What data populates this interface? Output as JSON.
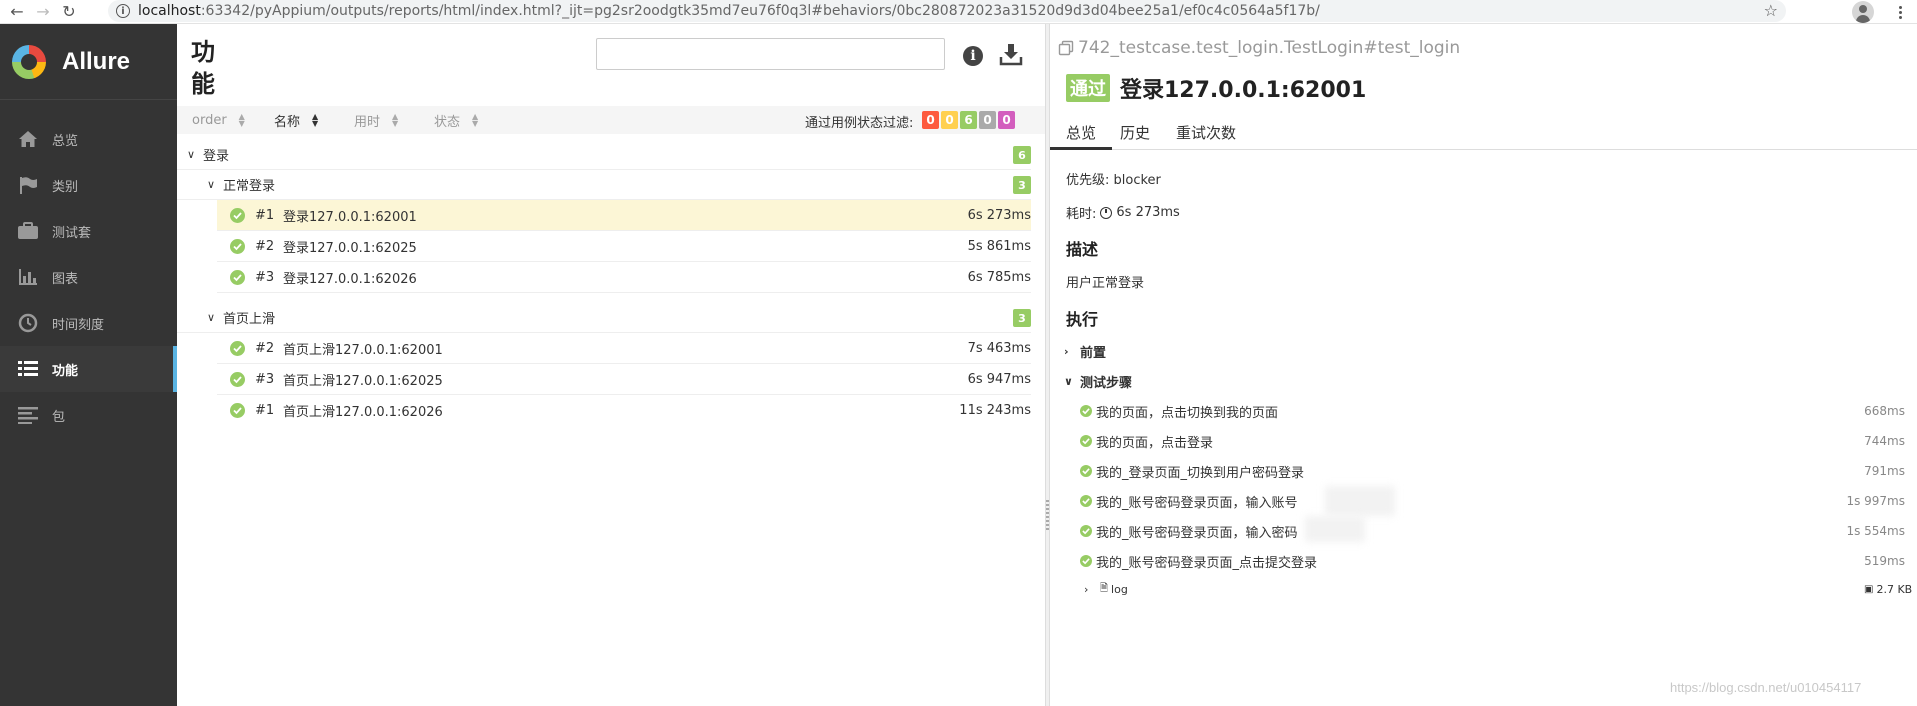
{
  "browser": {
    "url_host": "localhost",
    "url_path": ":63342/pyAppium/outputs/reports/html/index.html?_ijt=pg2sr2oodgtk35md7eu76f0q3l#behaviors/0bc280872023a31520d9d3d04bee25a1/ef0c4c0564a5f17b/"
  },
  "sidebar": {
    "brand": "Allure",
    "items": [
      {
        "label": "总览",
        "icon": "home-icon"
      },
      {
        "label": "类别",
        "icon": "flag-icon"
      },
      {
        "label": "测试套",
        "icon": "briefcase-icon"
      },
      {
        "label": "图表",
        "icon": "bar-chart-icon"
      },
      {
        "label": "时间刻度",
        "icon": "clock-icon"
      },
      {
        "label": "功能",
        "icon": "list-icon",
        "active": true
      },
      {
        "label": "包",
        "icon": "align-left-icon"
      }
    ]
  },
  "middle": {
    "title": "功能",
    "sort": [
      "order",
      "名称",
      "用时",
      "状态"
    ],
    "filter_label": "通过用例状态过滤:",
    "filter_counts": [
      {
        "value": "0",
        "color": "#fd5a3e"
      },
      {
        "value": "0",
        "color": "#ffd050"
      },
      {
        "value": "6",
        "color": "#97cc64"
      },
      {
        "value": "0",
        "color": "#aaaaaa"
      },
      {
        "value": "0",
        "color": "#d35ebe"
      }
    ],
    "tree": {
      "root": {
        "label": "登录",
        "count": "6"
      },
      "groups": [
        {
          "label": "正常登录",
          "count": "3",
          "cases": [
            {
              "num": "#1",
              "name": "登录127.0.0.1:62001",
              "duration": "6s 273ms",
              "selected": true
            },
            {
              "num": "#2",
              "name": "登录127.0.0.1:62025",
              "duration": "5s 861ms"
            },
            {
              "num": "#3",
              "name": "登录127.0.0.1:62026",
              "duration": "6s 785ms"
            }
          ]
        },
        {
          "label": "首页上滑",
          "count": "3",
          "cases": [
            {
              "num": "#2",
              "name": "首页上滑127.0.0.1:62001",
              "duration": "7s 463ms"
            },
            {
              "num": "#3",
              "name": "首页上滑127.0.0.1:62025",
              "duration": "6s 947ms"
            },
            {
              "num": "#1",
              "name": "首页上滑127.0.0.1:62026",
              "duration": "11s 243ms"
            }
          ]
        }
      ]
    }
  },
  "detail": {
    "path": "742_testcase.test_login.TestLogin#test_login",
    "status": "通过",
    "title": "登录127.0.0.1:62001",
    "tabs": [
      "总览",
      "历史",
      "重试次数"
    ],
    "severity_label": "优先级: blocker",
    "duration_label": "耗时:",
    "duration": "6s 273ms",
    "description_heading": "描述",
    "description": "用户正常登录",
    "execution_heading": "执行",
    "setup_label": "前置",
    "steps_label": "测试步骤",
    "steps": [
      {
        "name": "我的页面，点击切换到我的页面",
        "duration": "668ms"
      },
      {
        "name": "我的页面，点击登录",
        "duration": "744ms"
      },
      {
        "name": "我的_登录页面_切换到用户密码登录",
        "duration": "791ms"
      },
      {
        "name": "我的_账号密码登录页面，输入账号",
        "duration": "1s 997ms"
      },
      {
        "name": "我的_账号密码登录页面，输入密码",
        "duration": "1s 554ms"
      },
      {
        "name": "我的_账号密码登录页面_点击提交登录",
        "duration": "519ms"
      }
    ],
    "attachment": {
      "name": "log",
      "size": "2.7 KB"
    }
  },
  "watermark": "https://blog.csdn.net/u010454117"
}
